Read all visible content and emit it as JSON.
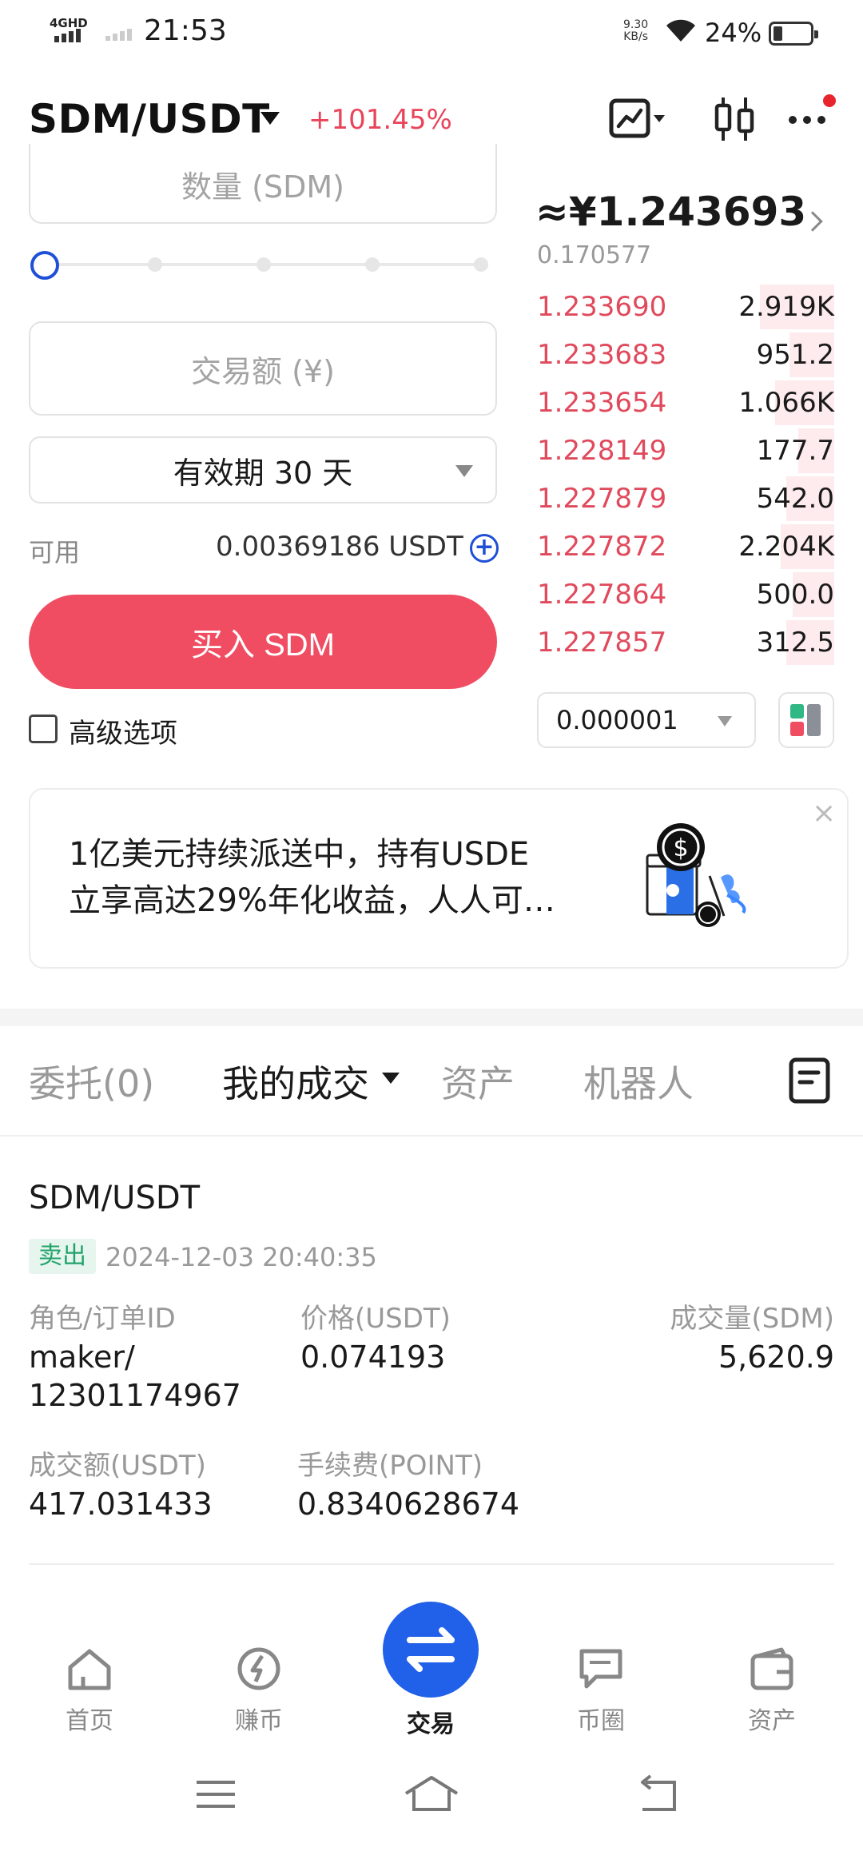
{
  "status_bar": {
    "network": "4GHD",
    "time": "21:53",
    "speed_value": "9.30",
    "speed_unit": "KB/s",
    "battery": "24%",
    "battery_level": 0.24
  },
  "header": {
    "pair": "SDM/USDT",
    "change": "+101.45%"
  },
  "form": {
    "quantity_placeholder": "数量 (SDM)",
    "amount_placeholder": "交易额 (¥)",
    "validity": "有效期 30 天",
    "available_label": "可用",
    "available_value": "0.00369186 USDT",
    "buy_button": "买入 SDM",
    "advanced_label": "高级选项"
  },
  "orderbook": {
    "last_price": "≈¥1.243693",
    "last_price_sub": "0.170577",
    "asks": [
      {
        "price": "1.233690",
        "qty": "2.919K",
        "depth": 0.25
      },
      {
        "price": "1.233683",
        "qty": "951.2",
        "depth": 0.15
      },
      {
        "price": "1.233654",
        "qty": "1.066K",
        "depth": 0.2
      },
      {
        "price": "1.228149",
        "qty": "177.7",
        "depth": 0.12
      },
      {
        "price": "1.227879",
        "qty": "542.0",
        "depth": 0.16
      },
      {
        "price": "1.227872",
        "qty": "2.204K",
        "depth": 0.18
      },
      {
        "price": "1.227864",
        "qty": "500.0",
        "depth": 0.14
      },
      {
        "price": "1.227857",
        "qty": "312.5",
        "depth": 0.16
      }
    ],
    "precision": "0.000001"
  },
  "banner": {
    "line1": "1亿美元持续派送中，持有USDE",
    "line2": "立享高达29%年化收益，人人可…",
    "close": "×"
  },
  "tabs": {
    "orders": "委托(0)",
    "my_trades": "我的成交",
    "assets": "资产",
    "bots": "机器人"
  },
  "trade": {
    "pair": "SDM/USDT",
    "side": "卖出",
    "time": "2024-12-03 20:40:35",
    "role_label": "角色/订单ID",
    "role_value_1": "maker/",
    "role_value_2": "12301174967",
    "price_label": "价格(USDT)",
    "price_value": "0.074193",
    "volume_label": "成交量(SDM)",
    "volume_value": "5,620.9",
    "amount_label": "成交额(USDT)",
    "amount_value": "417.031433",
    "fee_label": "手续费(POINT)",
    "fee_value": "0.8340628674"
  },
  "bottom_nav": {
    "home": "首页",
    "earn": "赚币",
    "trade": "交易",
    "feed": "币圈",
    "assets": "资产"
  },
  "colors": {
    "ask_red": "#e04a5c",
    "buy_button": "#f04d62",
    "accent_blue": "#2160e8",
    "sell_green": "#23a36a"
  }
}
